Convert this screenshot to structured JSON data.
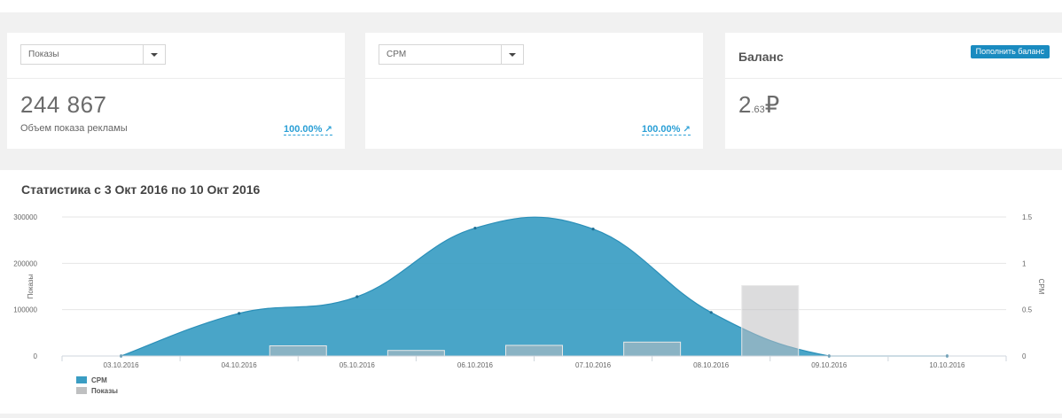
{
  "cards": {
    "impressions": {
      "select_value": "Показы",
      "value": "244 867",
      "caption": "Объем показа рекламы",
      "change": "100.00%",
      "change_icon": "↗"
    },
    "cpm": {
      "select_value": "CPM",
      "change": "100.00%",
      "change_icon": "↗"
    },
    "balance": {
      "title": "Баланс",
      "topup_button": "Пополнить баланс",
      "value_int": "2",
      "value_frac": ".63",
      "currency": "₽"
    }
  },
  "stats": {
    "title": "Статистика с 3 Окт 2016 по 10 Окт 2016"
  },
  "chart_data": {
    "type": "area",
    "categories": [
      "03.10.2016",
      "04.10.2016",
      "05.10.2016",
      "06.10.2016",
      "07.10.2016",
      "08.10.2016",
      "09.10.2016",
      "10.10.2016"
    ],
    "series": [
      {
        "name": "CPM",
        "type": "area",
        "axis": "right",
        "color": "#3a9dc3",
        "x": [
          0,
          1,
          2,
          3,
          4,
          5,
          6,
          7
        ],
        "values": [
          0,
          0.46,
          0.64,
          1.38,
          1.37,
          0.47,
          0,
          0
        ]
      },
      {
        "name": "Показы",
        "type": "bar",
        "axis": "left",
        "color": "#bfc0c1",
        "x": [
          0.5,
          1.5,
          2.5,
          3.5,
          4.5,
          5.5
        ],
        "values": [
          0,
          22000,
          12000,
          23000,
          30000,
          152000
        ]
      }
    ],
    "ylabel": "Показы",
    "y2label": "CPM",
    "ylim": [
      0,
      300000
    ],
    "y2lim": [
      0,
      1.5
    ],
    "yticks": [
      "0",
      "100000",
      "200000",
      "300000"
    ],
    "y2ticks": [
      "0",
      "0.5",
      "1",
      "1.5"
    ],
    "grid": true,
    "legend": "bottom-left"
  }
}
